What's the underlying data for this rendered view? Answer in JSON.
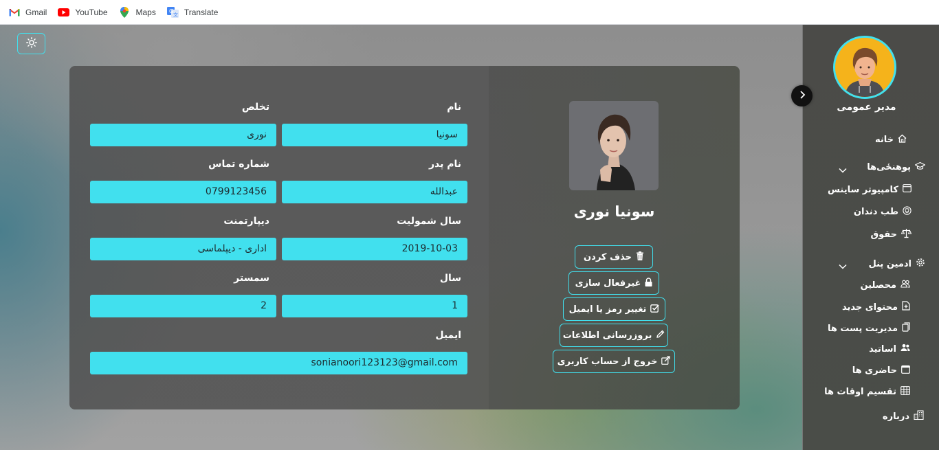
{
  "bookmarks": [
    {
      "label": "Gmail",
      "icon": "gmail-icon"
    },
    {
      "label": "YouTube",
      "icon": "youtube-icon"
    },
    {
      "label": "Maps",
      "icon": "maps-icon"
    },
    {
      "label": "Translate",
      "icon": "translate-icon"
    }
  ],
  "theme_toggle": {
    "icon": "sun-icon"
  },
  "profile": {
    "name": "سونیا نوری",
    "fields": {
      "first_name": {
        "label": "نام",
        "value": "سونیا"
      },
      "last_name": {
        "label": "تخلص",
        "value": "نوری"
      },
      "father_name": {
        "label": "نام پدر",
        "value": "عبدالله"
      },
      "phone": {
        "label": "شماره تماس",
        "value": "0799123456"
      },
      "join_year": {
        "label": "سال شمولیت",
        "value": "2019-10-03"
      },
      "department": {
        "label": "دیپارتمنت",
        "value": "اداری - دیپلماسی"
      },
      "year": {
        "label": "سال",
        "value": "1"
      },
      "semester": {
        "label": "سمستر",
        "value": "2"
      },
      "email": {
        "label": "ایمیل",
        "value": "sonianoori123123@gmail.com"
      }
    },
    "actions": {
      "delete": "حذف کردن",
      "deactivate": "غیرفعال سازی",
      "change_credentials": "تغییر رمز یا ایمیل",
      "update_info": "بروزرسانی اطلاعات",
      "logout": "خروج از حساب کاربری"
    }
  },
  "sidebar": {
    "role": "مدیر عمومی",
    "home": "خانه",
    "faculties": {
      "label": "پوهنځی‌ها",
      "items": [
        "کامپیوتر ساینس",
        "طب دندان",
        "حقوق"
      ]
    },
    "admin_panel": {
      "label": "ادمین پنل",
      "items": [
        "محصلین",
        "محتوای جدید",
        "مدیریت پست ها",
        "اساتید",
        "حاضری ها",
        "تقسیم اوقات ها"
      ]
    },
    "about": "درباره"
  },
  "colors": {
    "accent": "#41e0ee",
    "avatar_bg": "#f5b31b"
  }
}
